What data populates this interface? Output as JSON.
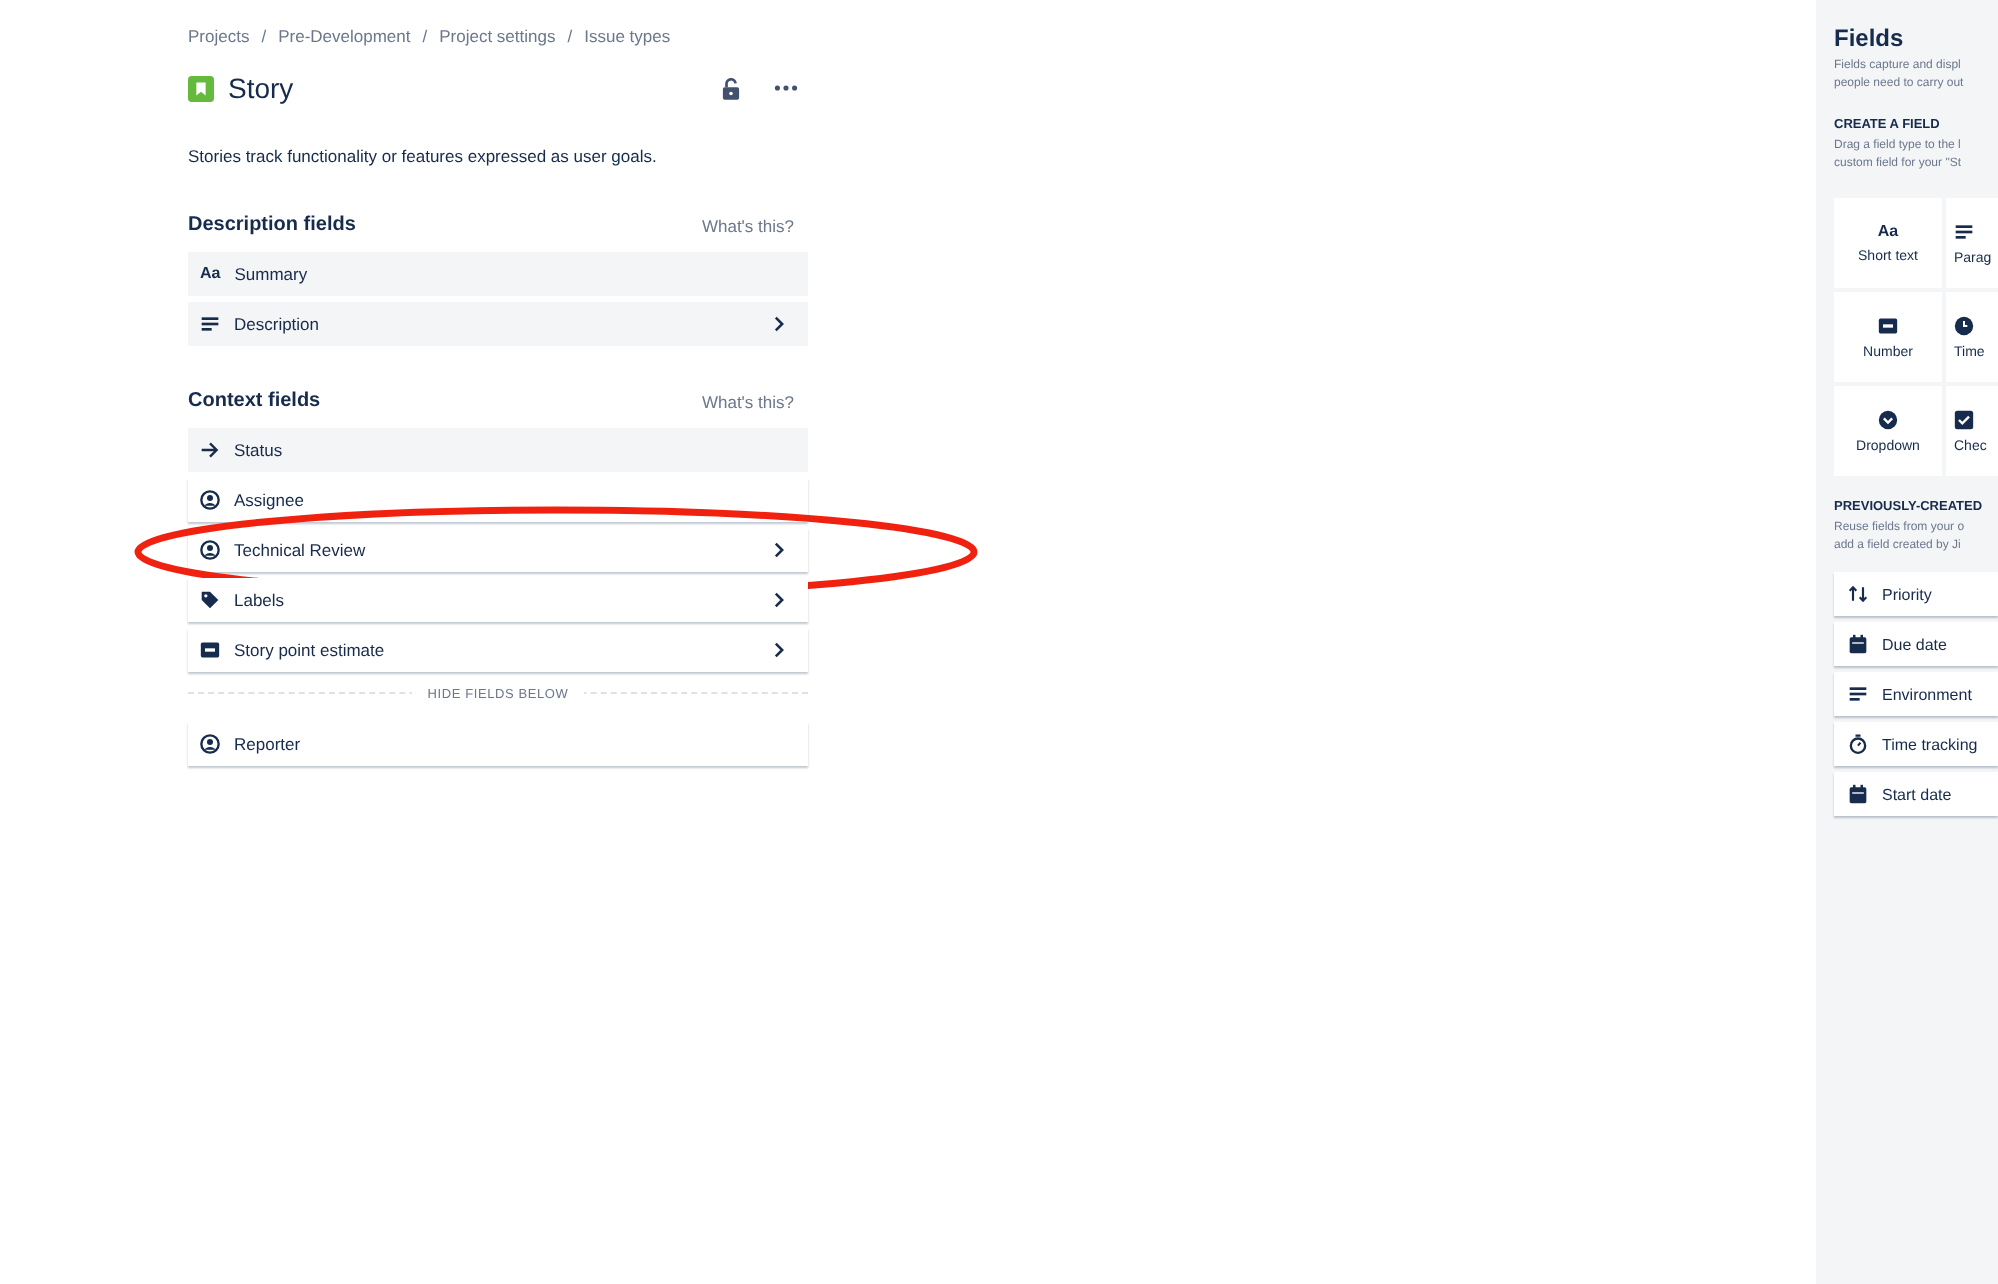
{
  "breadcrumbs": [
    "Projects",
    "Pre-Development",
    "Project settings",
    "Issue types"
  ],
  "breadcrumb_separator": "/",
  "title": "Story",
  "description": "Stories track functionality or features expressed as user goals.",
  "sections": [
    {
      "heading": "Description fields",
      "help": "What's this?",
      "fields": [
        {
          "label": "Summary",
          "kind": "text",
          "icon_text": "Aa",
          "chevron": false,
          "locked": true,
          "circled": false
        },
        {
          "label": "Description",
          "kind": "paragraph",
          "chevron": true,
          "locked": true,
          "circled": false
        }
      ]
    },
    {
      "heading": "Context fields",
      "help": "What's this?",
      "fields": [
        {
          "label": "Status",
          "kind": "status",
          "chevron": false,
          "locked": true,
          "circled": false
        },
        {
          "label": "Assignee",
          "kind": "user",
          "chevron": false,
          "locked": false,
          "circled": false
        },
        {
          "label": "Technical Review",
          "kind": "user",
          "chevron": true,
          "locked": false,
          "circled": true
        },
        {
          "label": "Labels",
          "kind": "labels",
          "chevron": true,
          "locked": false,
          "circled": false
        },
        {
          "label": "Story point estimate",
          "kind": "number",
          "chevron": true,
          "locked": false,
          "circled": false
        }
      ],
      "divider": "HIDE FIELDS BELOW",
      "hidden_fields": [
        {
          "label": "Reporter",
          "kind": "user",
          "chevron": false,
          "locked": false,
          "circled": false
        }
      ]
    }
  ],
  "panel": {
    "title": "Fields",
    "intro": [
      "Fields capture and displ",
      "people need to carry out"
    ],
    "create": {
      "heading": "CREATE A FIELD",
      "text": [
        "Drag a field type to the l",
        "custom field for your \"St"
      ],
      "types": [
        {
          "label": "Short text",
          "kind": "text",
          "icon_text": "Aa"
        },
        {
          "label": "Parag",
          "kind": "paragraph"
        },
        {
          "label": "Number",
          "kind": "number"
        },
        {
          "label": "Time",
          "kind": "time"
        },
        {
          "label": "Dropdown",
          "kind": "dropdown"
        },
        {
          "label": "Chec",
          "kind": "checkbox"
        }
      ]
    },
    "previous": {
      "heading": "PREVIOUSLY-CREATED",
      "text": [
        "Reuse fields from your o",
        "add a field created by Ji"
      ],
      "fields": [
        {
          "label": "Priority",
          "kind": "priority"
        },
        {
          "label": "Due date",
          "kind": "date"
        },
        {
          "label": "Environment",
          "kind": "paragraph"
        },
        {
          "label": "Time tracking",
          "kind": "stopwatch"
        },
        {
          "label": "Start date",
          "kind": "date"
        }
      ]
    }
  }
}
